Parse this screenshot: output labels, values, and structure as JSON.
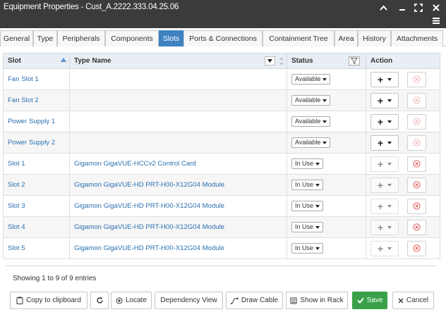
{
  "window": {
    "title": "Equipment Properties - Cust_A.2222.333.04.25.06"
  },
  "tabs": [
    {
      "label": "General"
    },
    {
      "label": "Type"
    },
    {
      "label": "Peripherals"
    },
    {
      "label": "Components"
    },
    {
      "label": "Slots"
    },
    {
      "label": "Ports & Connections"
    },
    {
      "label": "Containment Tree"
    },
    {
      "label": "Area"
    },
    {
      "label": "History"
    },
    {
      "label": "Attachments"
    }
  ],
  "active_tab": "Slots",
  "table": {
    "headers": {
      "slot": "Slot",
      "type_name": "Type Name",
      "status": "Status",
      "action": "Action"
    },
    "rows": [
      {
        "slot": "Fan Slot 1",
        "type_name": "",
        "status": "Available"
      },
      {
        "slot": "Fan Slot 2",
        "type_name": "",
        "status": "Available"
      },
      {
        "slot": "Power Supply 1",
        "type_name": "",
        "status": "Available"
      },
      {
        "slot": "Power Supply 2",
        "type_name": "",
        "status": "Available"
      },
      {
        "slot": "Slot 1",
        "type_name": "Gigamon GigaVUE-HCCv2 Control Card",
        "status": "In Use"
      },
      {
        "slot": "Slot 2",
        "type_name": "Gigamon GigaVUE-HD PRT-H00-X12G04 Module",
        "status": "In Use"
      },
      {
        "slot": "Slot 3",
        "type_name": "Gigamon GigaVUE-HD PRT-H00-X12G04 Module",
        "status": "In Use"
      },
      {
        "slot": "Slot 4",
        "type_name": "Gigamon GigaVUE-HD PRT-H00-X12G04 Module",
        "status": "In Use"
      },
      {
        "slot": "Slot 5",
        "type_name": "Gigamon GigaVUE-HD PRT-H00-X12G04 Module",
        "status": "In Use"
      }
    ]
  },
  "footer": {
    "info": "Showing 1 to 9 of 9 entries"
  },
  "buttons": {
    "copy": "Copy to clipboard",
    "locate": "Locate",
    "dependency": "Dependency View",
    "draw_cable": "Draw Cable",
    "show_rack": "Show in Rack",
    "save": "Save",
    "cancel": "Cancel"
  },
  "colors": {
    "accent": "#3f82c0",
    "save": "#3aa14a",
    "titlebar": "#3b3b3b",
    "link": "#2a6fae",
    "remove": "#e05a5a"
  }
}
